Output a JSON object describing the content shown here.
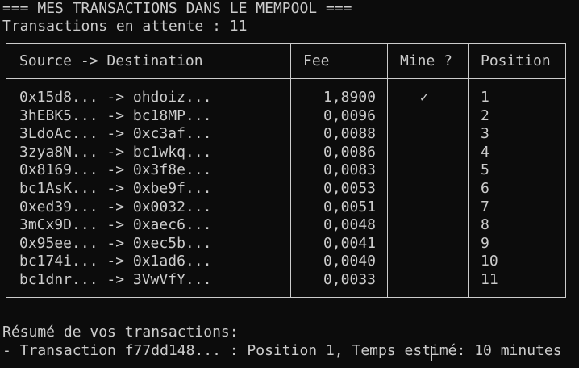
{
  "terminal": {
    "title": "=== MES TRANSACTIONS DANS LE MEMPOOL ===",
    "pending_label": "Transactions en attente : 11"
  },
  "table": {
    "headers": {
      "route": "Source -> Destination",
      "fee": "Fee",
      "mine": "Mine ?",
      "position": "Position"
    },
    "rows": [
      {
        "route": "0x15d8... -> ohdoiz...",
        "fee": "1,8900",
        "mine": "✓",
        "position": "1"
      },
      {
        "route": "3hEBK5... -> bc18MP...",
        "fee": "0,0096",
        "mine": "",
        "position": "2"
      },
      {
        "route": "3LdoAc... -> 0xc3af...",
        "fee": "0,0088",
        "mine": "",
        "position": "3"
      },
      {
        "route": "3zya8N... -> bc1wkq...",
        "fee": "0,0086",
        "mine": "",
        "position": "4"
      },
      {
        "route": "0x8169... -> 0x3f8e...",
        "fee": "0,0083",
        "mine": "",
        "position": "5"
      },
      {
        "route": "bc1AsK... -> 0xbe9f...",
        "fee": "0,0053",
        "mine": "",
        "position": "6"
      },
      {
        "route": "0xed39... -> 0x0032...",
        "fee": "0,0051",
        "mine": "",
        "position": "7"
      },
      {
        "route": "3mCx9D... -> 0xaec6...",
        "fee": "0,0048",
        "mine": "",
        "position": "8"
      },
      {
        "route": "0x95ee... -> 0xec5b...",
        "fee": "0,0041",
        "mine": "",
        "position": "9"
      },
      {
        "route": "bc174i... -> 0x1ad6...",
        "fee": "0,0040",
        "mine": "",
        "position": "10"
      },
      {
        "route": "bc1dnr... -> 3VwVfY...",
        "fee": "0,0033",
        "mine": "",
        "position": "11"
      }
    ]
  },
  "summary": {
    "title": "Résumé de vos transactions:",
    "line": "- Transaction f77dd148... : Position 1, Temps estimé: 10 minutes"
  },
  "colors": {
    "background": "#0c0c0c",
    "foreground": "#cccccc"
  }
}
